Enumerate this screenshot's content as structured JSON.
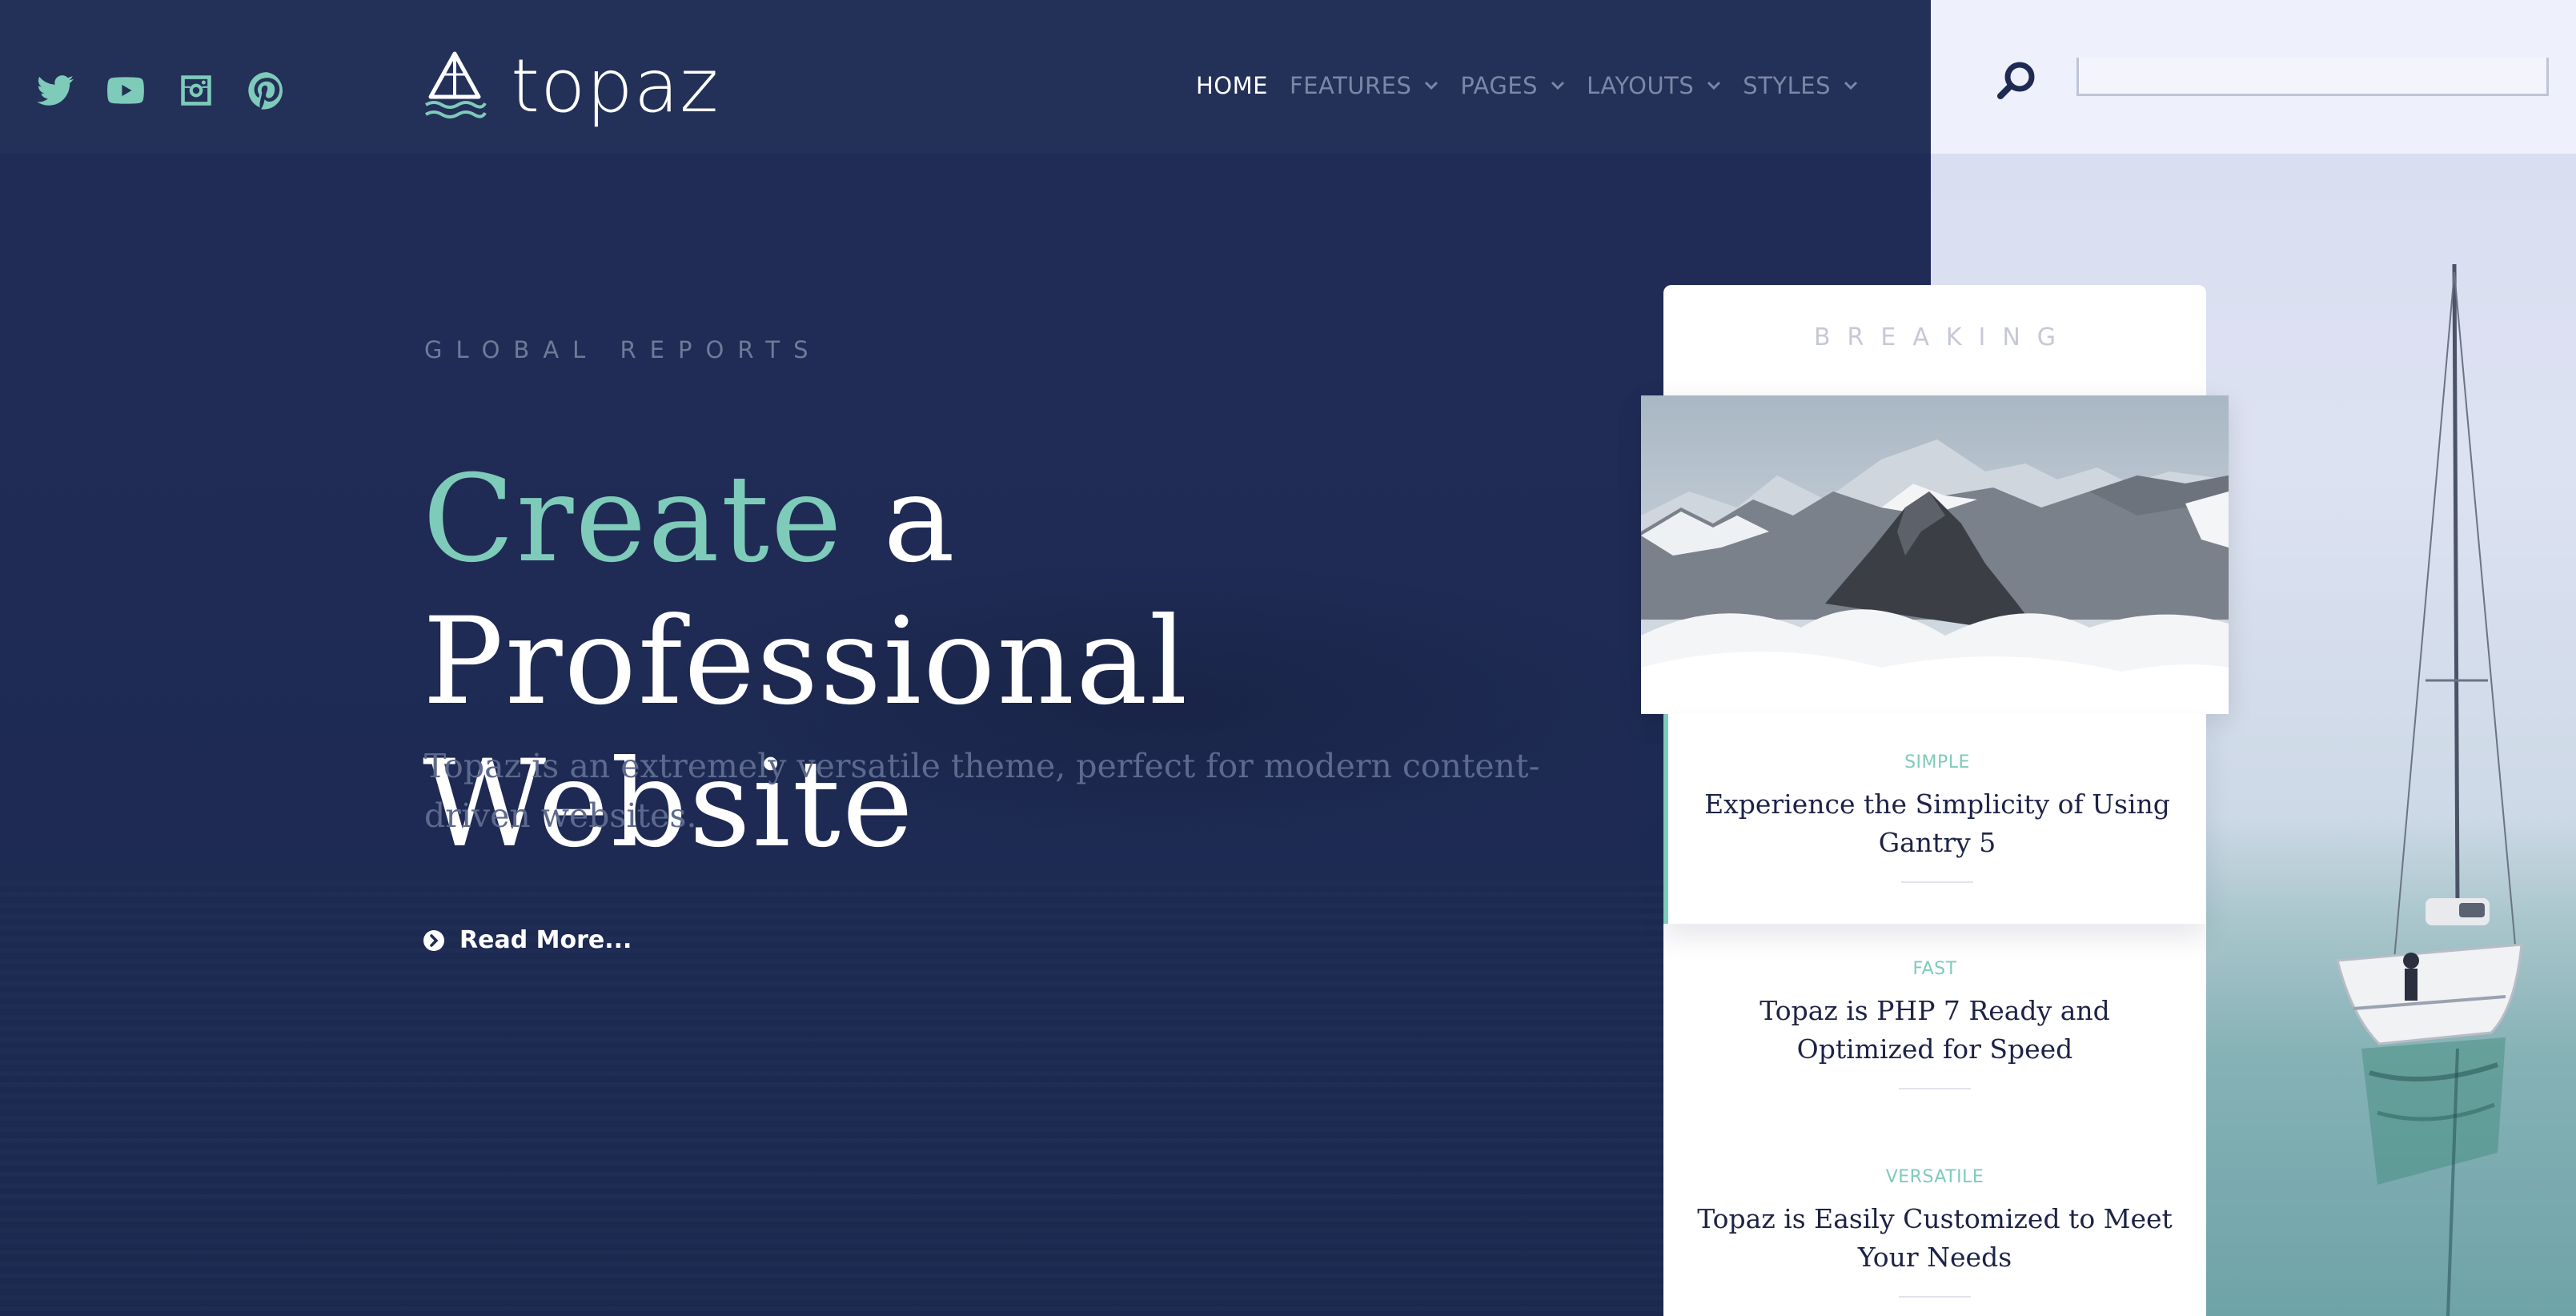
{
  "colors": {
    "accent": "#7ecbb9",
    "navy": "#1e2a52",
    "header": "#233058",
    "muted_text": "#5d6a8e"
  },
  "social": [
    {
      "name": "twitter-icon"
    },
    {
      "name": "youtube-icon"
    },
    {
      "name": "instagram-icon"
    },
    {
      "name": "pinterest-icon"
    }
  ],
  "brand": {
    "logo_text": "topaz"
  },
  "nav": {
    "items": [
      {
        "label": "HOME",
        "active": true,
        "dropdown": false
      },
      {
        "label": "FEATURES",
        "active": false,
        "dropdown": true
      },
      {
        "label": "PAGES",
        "active": false,
        "dropdown": true
      },
      {
        "label": "LAYOUTS",
        "active": false,
        "dropdown": true
      },
      {
        "label": "STYLES",
        "active": false,
        "dropdown": true
      }
    ]
  },
  "search": {
    "value": "",
    "placeholder": ""
  },
  "hero": {
    "eyebrow": "GLOBAL REPORTS",
    "headline_accent": "Create",
    "headline_rest": " a Professional Website",
    "subtext": "Topaz is an extremely versatile theme, perfect for modern content-driven websites.",
    "cta": "Read More..."
  },
  "breaking": {
    "title": "BREAKING",
    "stories": [
      {
        "category": "SIMPLE",
        "title": "Experience the Simplicity of Using Gantry 5"
      },
      {
        "category": "FAST",
        "title": "Topaz is PHP 7 Ready and Optimized for Speed"
      },
      {
        "category": "VERSATILE",
        "title": "Topaz is Easily Customized to Meet Your Needs"
      }
    ]
  }
}
